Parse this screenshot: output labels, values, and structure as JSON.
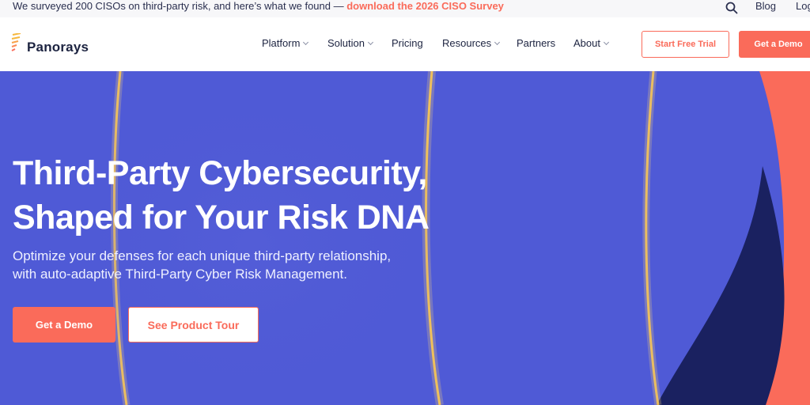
{
  "announcement": {
    "text": "We surveyed 200 CISOs on third-party risk, and here’s what we found — ",
    "link_text": "download the 2026 CISO Survey"
  },
  "utility_nav": {
    "search_icon": "search-icon",
    "blog_label": "Blog",
    "login_label": "Log"
  },
  "brand": {
    "name": "Panorays",
    "logo_colors": [
      "#f6b73c",
      "#fa6b5a"
    ]
  },
  "nav": {
    "items": [
      {
        "label": "Platform",
        "has_dropdown": true
      },
      {
        "label": "Solution",
        "has_dropdown": true
      },
      {
        "label": "Pricing",
        "has_dropdown": false
      },
      {
        "label": "Resources",
        "has_dropdown": true
      },
      {
        "label": "Partners",
        "has_dropdown": false
      },
      {
        "label": "About",
        "has_dropdown": true
      }
    ],
    "trial_label": "Start Free Trial",
    "demo_label": "Get a Demo"
  },
  "hero": {
    "headline_line1": "Third-Party Cybersecurity,",
    "headline_line2": "Shaped for Your Risk DNA",
    "subhead_line1": "Optimize your defenses for each unique third-party relationship,",
    "subhead_line2": "with auto-adaptive Third-Party Cyber Risk Management.",
    "primary_cta": "Get a Demo",
    "secondary_cta": "See Product Tour"
  },
  "colors": {
    "accent": "#fa6b5a",
    "hero_bg": "#4f5ad6",
    "navy": "#1c2340",
    "glow": "#f6c04a"
  }
}
